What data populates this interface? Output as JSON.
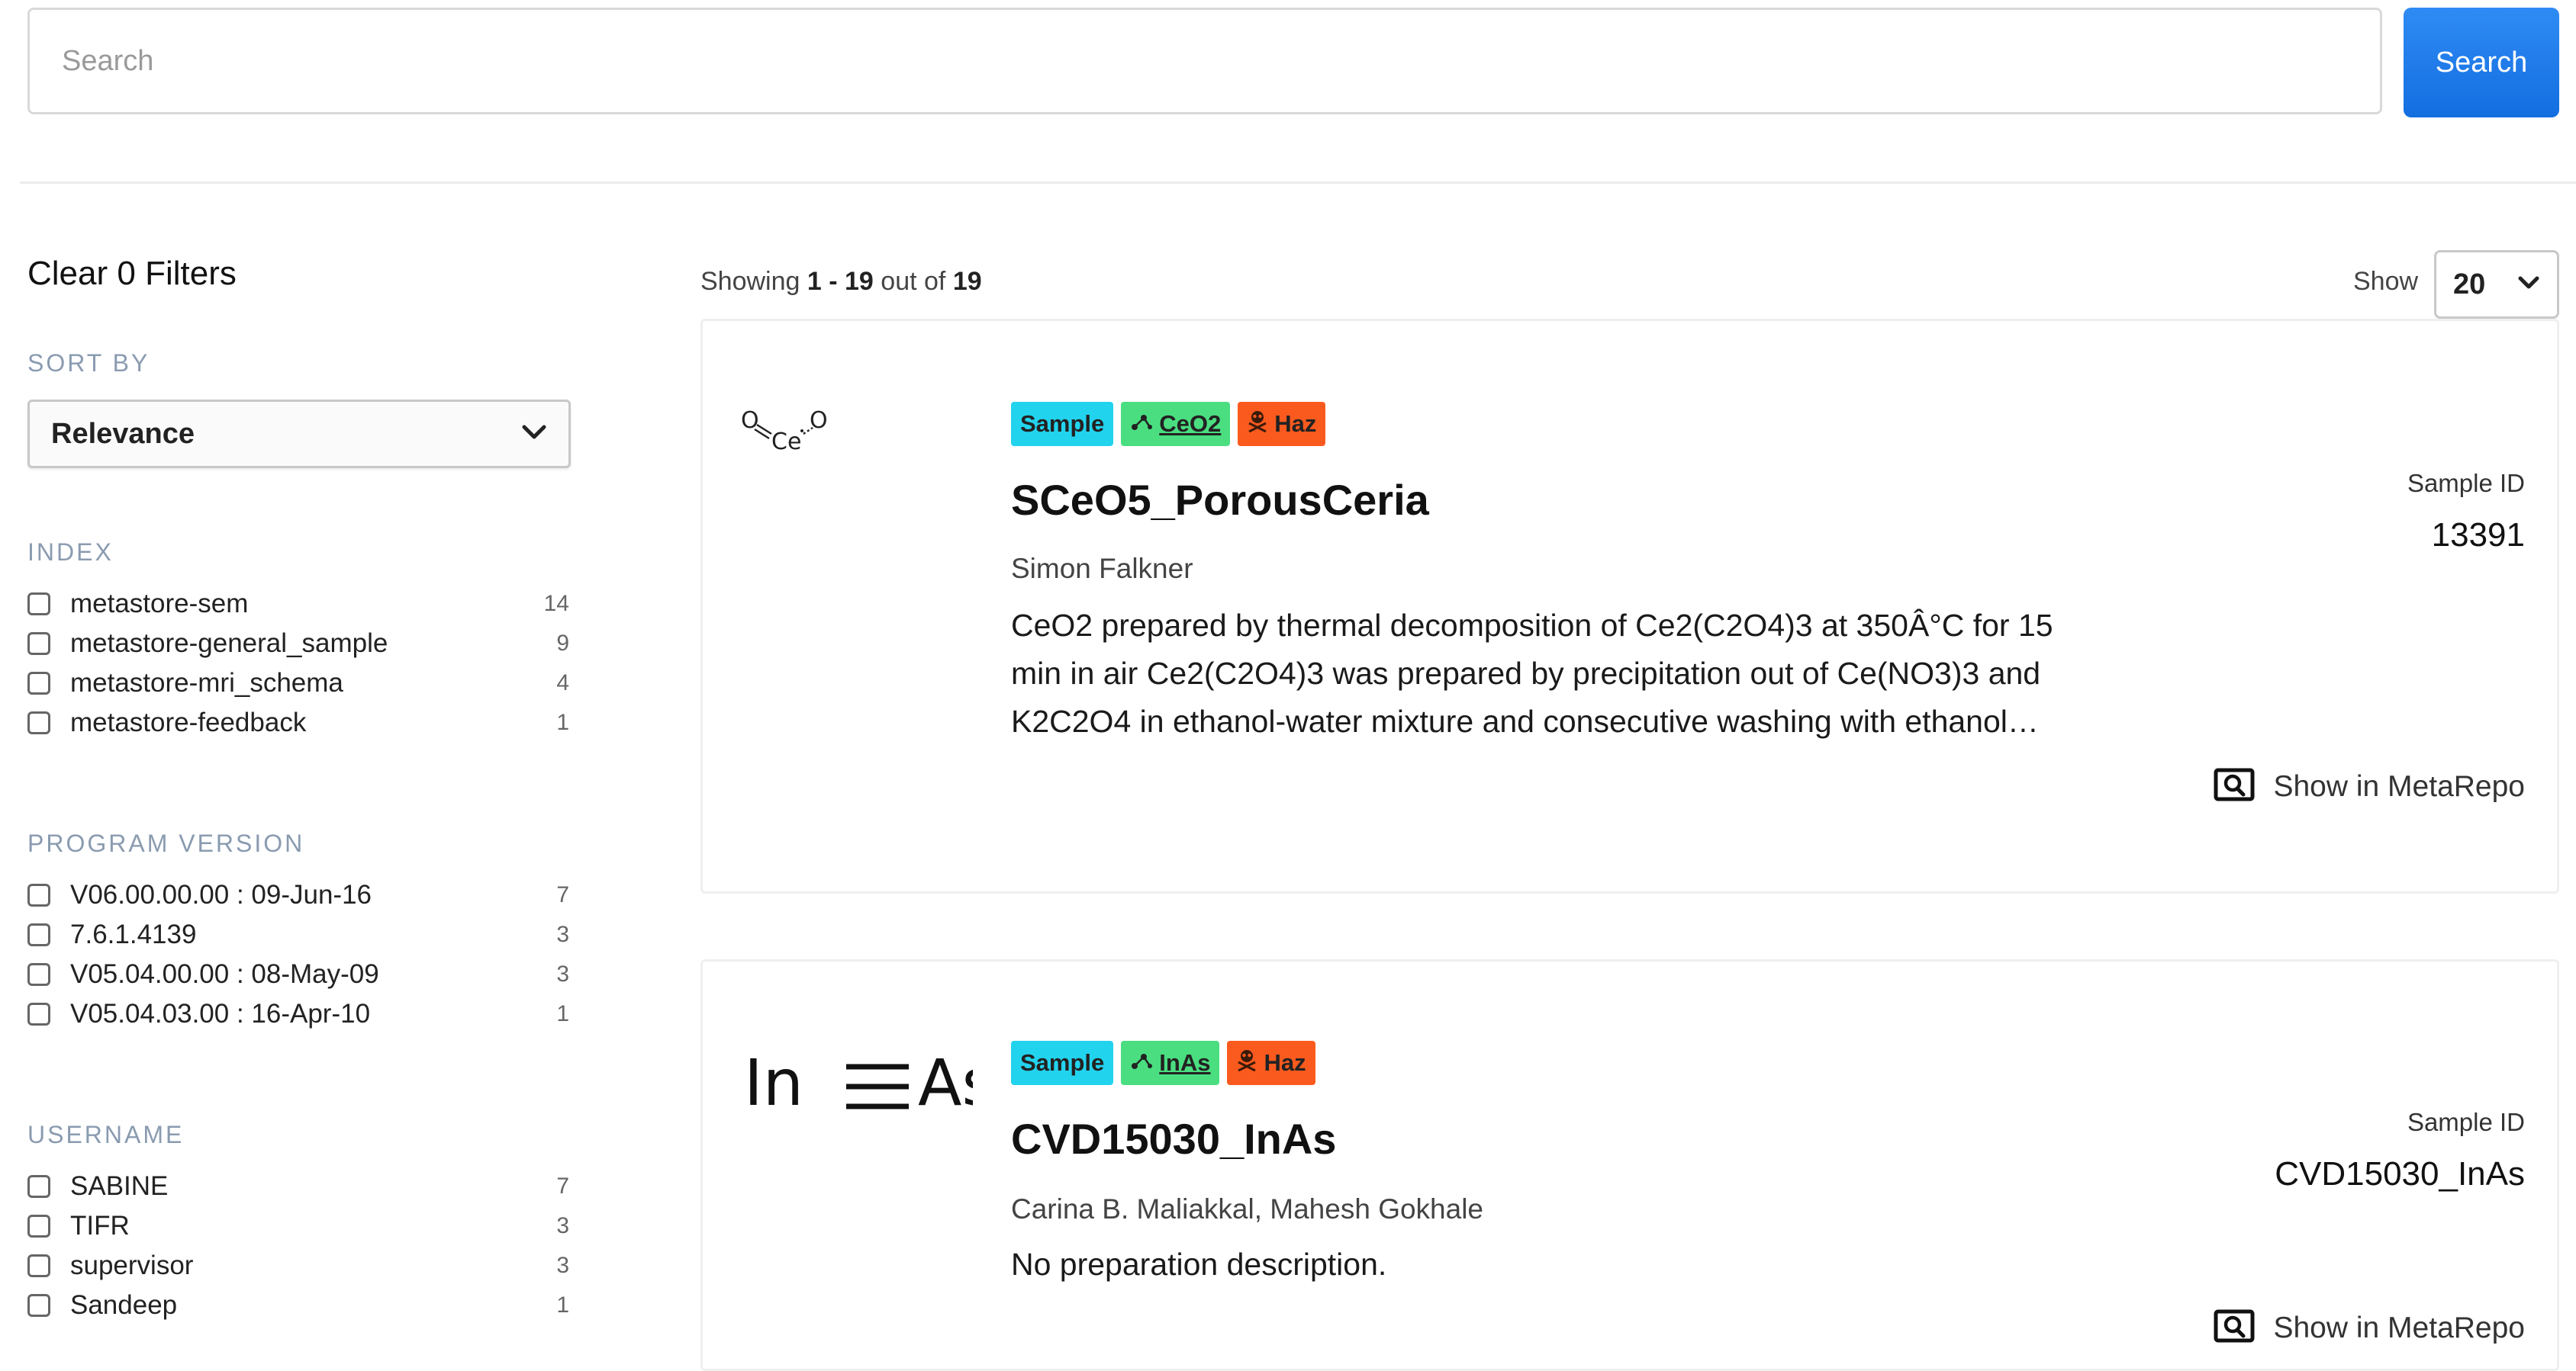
{
  "search": {
    "placeholder": "Search",
    "value": "",
    "button_label": "Search"
  },
  "sidebar": {
    "clear_filters_label": "Clear 0 Filters",
    "sort": {
      "heading": "SORT BY",
      "selected": "Relevance"
    },
    "facets": {
      "index": {
        "heading": "INDEX",
        "items": [
          {
            "label": "metastore-sem",
            "count": "14"
          },
          {
            "label": "metastore-general_sample",
            "count": "9"
          },
          {
            "label": "metastore-mri_schema",
            "count": "4"
          },
          {
            "label": "metastore-feedback",
            "count": "1"
          }
        ]
      },
      "program_version": {
        "heading": "PROGRAM VERSION",
        "items": [
          {
            "label": "V06.00.00.00 : 09-Jun-16",
            "count": "7"
          },
          {
            "label": "7.6.1.4139",
            "count": "3"
          },
          {
            "label": "V05.04.00.00 : 08-May-09",
            "count": "3"
          },
          {
            "label": "V05.04.03.00 : 16-Apr-10",
            "count": "1"
          }
        ]
      },
      "username": {
        "heading": "USERNAME",
        "items": [
          {
            "label": "SABINE",
            "count": "7"
          },
          {
            "label": "TIFR",
            "count": "3"
          },
          {
            "label": "supervisor",
            "count": "3"
          },
          {
            "label": "Sandeep",
            "count": "1"
          }
        ]
      }
    }
  },
  "results": {
    "showing_prefix": "Showing",
    "range": "1 - 19",
    "out_of_text": "out of",
    "total": "19",
    "show_label": "Show",
    "page_size": "20",
    "items": [
      {
        "structure_icon": "ceo2-structure-diagram",
        "structure": {
          "o1": "O",
          "ce": "Ce",
          "o2": "O"
        },
        "badges": {
          "type": "Sample",
          "molecule": "CeO2",
          "hazard": "Haz"
        },
        "title": "SCeO5_PorousCeria",
        "authors": "Simon Falkner",
        "description": "CeO2 prepared by thermal decomposition of Ce2(C2O4)3 at 350Â°C for 15 min in air Ce2(C2O4)3 was prepared by precipitation out of Ce(NO3)3 and K2C2O4 in ethanol-water mixture and consecutive washing with ethanol…",
        "id_label": "Sample ID",
        "id_value": "13391",
        "link_label": "Show in MetaRepo"
      },
      {
        "structure_icon": "inas-structure-diagram",
        "structure": {
          "left": "In",
          "right": "As"
        },
        "badges": {
          "type": "Sample",
          "molecule": "InAs",
          "hazard": "Haz"
        },
        "title": "CVD15030_InAs",
        "authors": "Carina B. Maliakkal, Mahesh Gokhale",
        "description": "No preparation description.",
        "id_label": "Sample ID",
        "id_value": "CVD15030_InAs",
        "link_label": "Show in MetaRepo"
      }
    ]
  },
  "colors": {
    "primary_button": "#1a73e8",
    "badge_sample": "#22d3ee",
    "badge_molecule": "#4ade80",
    "badge_hazard": "#fb5a1e",
    "facet_heading": "#8a9bb0"
  }
}
